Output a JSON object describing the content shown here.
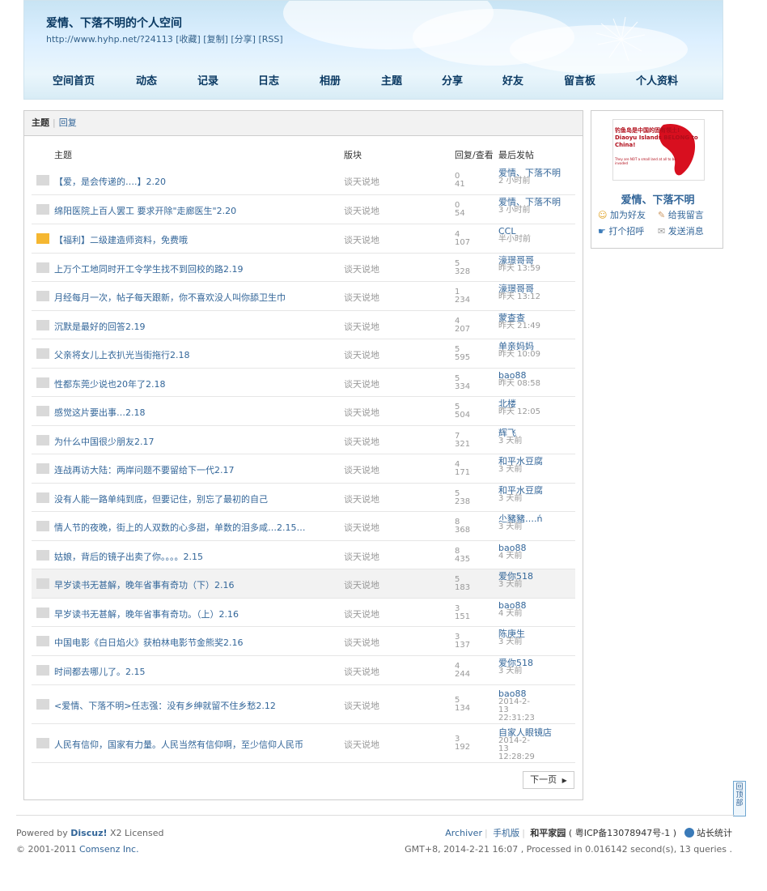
{
  "header": {
    "site_title": "爱情、下落不明的个人空间",
    "site_url": "http://www.hyhp.net/?24113",
    "url_actions": [
      "[收藏]",
      "[复制]",
      "[分享]",
      "[RSS]"
    ],
    "nav": [
      "空间首页",
      "动态",
      "记录",
      "日志",
      "相册",
      "主题",
      "分享",
      "好友",
      "留言板",
      "个人资料"
    ]
  },
  "tabs": [
    "主题",
    "回复"
  ],
  "columns": {
    "subject": "主题",
    "forum": "版块",
    "replies_views": "回复/查看",
    "last_post": "最后发帖"
  },
  "threads": [
    {
      "title": "【爱，是会传递的….】2.20",
      "forum": "谈天说地",
      "replies": "0",
      "views": "41",
      "last_user": "爱情、下落不明",
      "last_time": "2 小时前",
      "folder": "gray"
    },
    {
      "title": "绵阳医院上百人罢工 要求开除\"走廊医生\"2.20",
      "forum": "谈天说地",
      "replies": "0",
      "views": "54",
      "last_user": "爱情、下落不明",
      "last_time": "3 小时前",
      "folder": "gray"
    },
    {
      "title": "【福利】二级建造师资料，免费哦",
      "forum": "谈天说地",
      "replies": "4",
      "views": "107",
      "last_user": "CCL",
      "last_time": "半小时前",
      "folder": "yellow"
    },
    {
      "title": "上万个工地同时开工令学生找不到回校的路2.19",
      "forum": "谈天说地",
      "replies": "5",
      "views": "328",
      "last_user": "濠璟哥哥",
      "last_time": "昨天 13:59",
      "folder": "gray"
    },
    {
      "title": "月经每月一次，帖子每天跟新，你不喜欢没人叫你舔卫生巾",
      "forum": "谈天说地",
      "replies": "1",
      "views": "234",
      "last_user": "濠璟哥哥",
      "last_time": "昨天 13:12",
      "folder": "gray"
    },
    {
      "title": "沉默是最好的回答2.19",
      "forum": "谈天说地",
      "replies": "4",
      "views": "207",
      "last_user": "蒙查查",
      "last_time": "昨天 21:49",
      "folder": "gray"
    },
    {
      "title": "父亲将女儿上衣扒光当街拖行2.18",
      "forum": "谈天说地",
      "replies": "5",
      "views": "595",
      "last_user": "单亲妈妈",
      "last_time": "昨天 10:09",
      "folder": "gray"
    },
    {
      "title": "性都东莞少说也20年了2.18",
      "forum": "谈天说地",
      "replies": "5",
      "views": "334",
      "last_user": "bao88",
      "last_time": "昨天 08:58",
      "folder": "gray"
    },
    {
      "title": "感觉这片要出事…2.18",
      "forum": "谈天说地",
      "replies": "5",
      "views": "504",
      "last_user": "北楼",
      "last_time": "昨天 12:05",
      "folder": "gray"
    },
    {
      "title": "为什么中国很少朋友2.17",
      "forum": "谈天说地",
      "replies": "7",
      "views": "321",
      "last_user": "辉飞",
      "last_time": "3 天前",
      "folder": "gray"
    },
    {
      "title": "连战再访大陆：两岸问题不要留给下一代2.17",
      "forum": "谈天说地",
      "replies": "4",
      "views": "171",
      "last_user": "和平水豆腐",
      "last_time": "3 天前",
      "folder": "gray"
    },
    {
      "title": "没有人能一路单纯到底，但要记住，别忘了最初的自己",
      "forum": "谈天说地",
      "replies": "5",
      "views": "238",
      "last_user": "和平水豆腐",
      "last_time": "3 天前",
      "folder": "gray"
    },
    {
      "title": "情人节的夜晚，街上的人双数的心多甜，单数的泪多咸…2.15…",
      "forum": "谈天说地",
      "replies": "8",
      "views": "368",
      "last_user": "尐豬豬….ń",
      "last_time": "3 天前",
      "folder": "gray"
    },
    {
      "title": "姑娘，背后的镜子出卖了你。。。。2.15",
      "forum": "谈天说地",
      "replies": "8",
      "views": "435",
      "last_user": "bao88",
      "last_time": "4 天前",
      "folder": "gray"
    },
    {
      "title": "早岁读书无甚解，晚年省事有奇功（下）2.16",
      "forum": "谈天说地",
      "replies": "5",
      "views": "183",
      "last_user": "爱你518",
      "last_time": "3 天前",
      "folder": "gray",
      "highlight": true
    },
    {
      "title": "早岁读书无甚解，晚年省事有奇功。（上）2.16",
      "forum": "谈天说地",
      "replies": "3",
      "views": "151",
      "last_user": "bao88",
      "last_time": "4 天前",
      "folder": "gray"
    },
    {
      "title": "中国电影《白日焰火》获柏林电影节金熊奖2.16",
      "forum": "谈天说地",
      "replies": "3",
      "views": "137",
      "last_user": "陈庚生",
      "last_time": "3 天前",
      "folder": "gray"
    },
    {
      "title": "时间都去哪儿了。2.15",
      "forum": "谈天说地",
      "replies": "4",
      "views": "244",
      "last_user": "爱你518",
      "last_time": "3 天前",
      "folder": "gray"
    },
    {
      "title": "<爱情、下落不明>任志强：没有乡绅就留不住乡愁2.12",
      "forum": "谈天说地",
      "replies": "5",
      "views": "134",
      "last_user": "bao88",
      "last_time": "2014-2-13 22:31:23",
      "folder": "gray"
    },
    {
      "title": "人民有信仰，国家有力量。人民当然有信仰啊，至少信仰人民币",
      "forum": "谈天说地",
      "replies": "3",
      "views": "192",
      "last_user": "自家人眼镜店",
      "last_time": "2014-2-13 12:28:29",
      "folder": "gray"
    }
  ],
  "pagination": {
    "next": "下一页"
  },
  "sidebar": {
    "banner_text": "钓鱼岛是中国的固有领土! Diaoyu Islands BELONG to China!",
    "banner_small": "They are NOT a small land at all to be invaded",
    "name": "爱情、下落不明",
    "actions": [
      "加为好友",
      "给我留言",
      "打个招呼",
      "发送消息"
    ]
  },
  "back_to_top": "回顶部",
  "footer": {
    "powered_prefix": "Powered by",
    "discuz": "Discuz!",
    "powered_suffix": "X2 Licensed",
    "copyright_prefix": "© 2001-2011",
    "copyright_link": "Comsenz Inc.",
    "links": [
      "Archiver",
      "手机版",
      "和平家园"
    ],
    "icp": "( 粤ICP备13078947号-1 )",
    "stats": "站长统计",
    "processed": "GMT+8, 2014-2-21 16:07 , Processed in 0.016142 second(s), 13 queries ."
  },
  "colors": {
    "link": "#336699",
    "nav": "#0b3a63",
    "folder_gray": "#d9d9d9",
    "folder_yellow": "#f5b731",
    "banner_red": "#d80f1f"
  }
}
